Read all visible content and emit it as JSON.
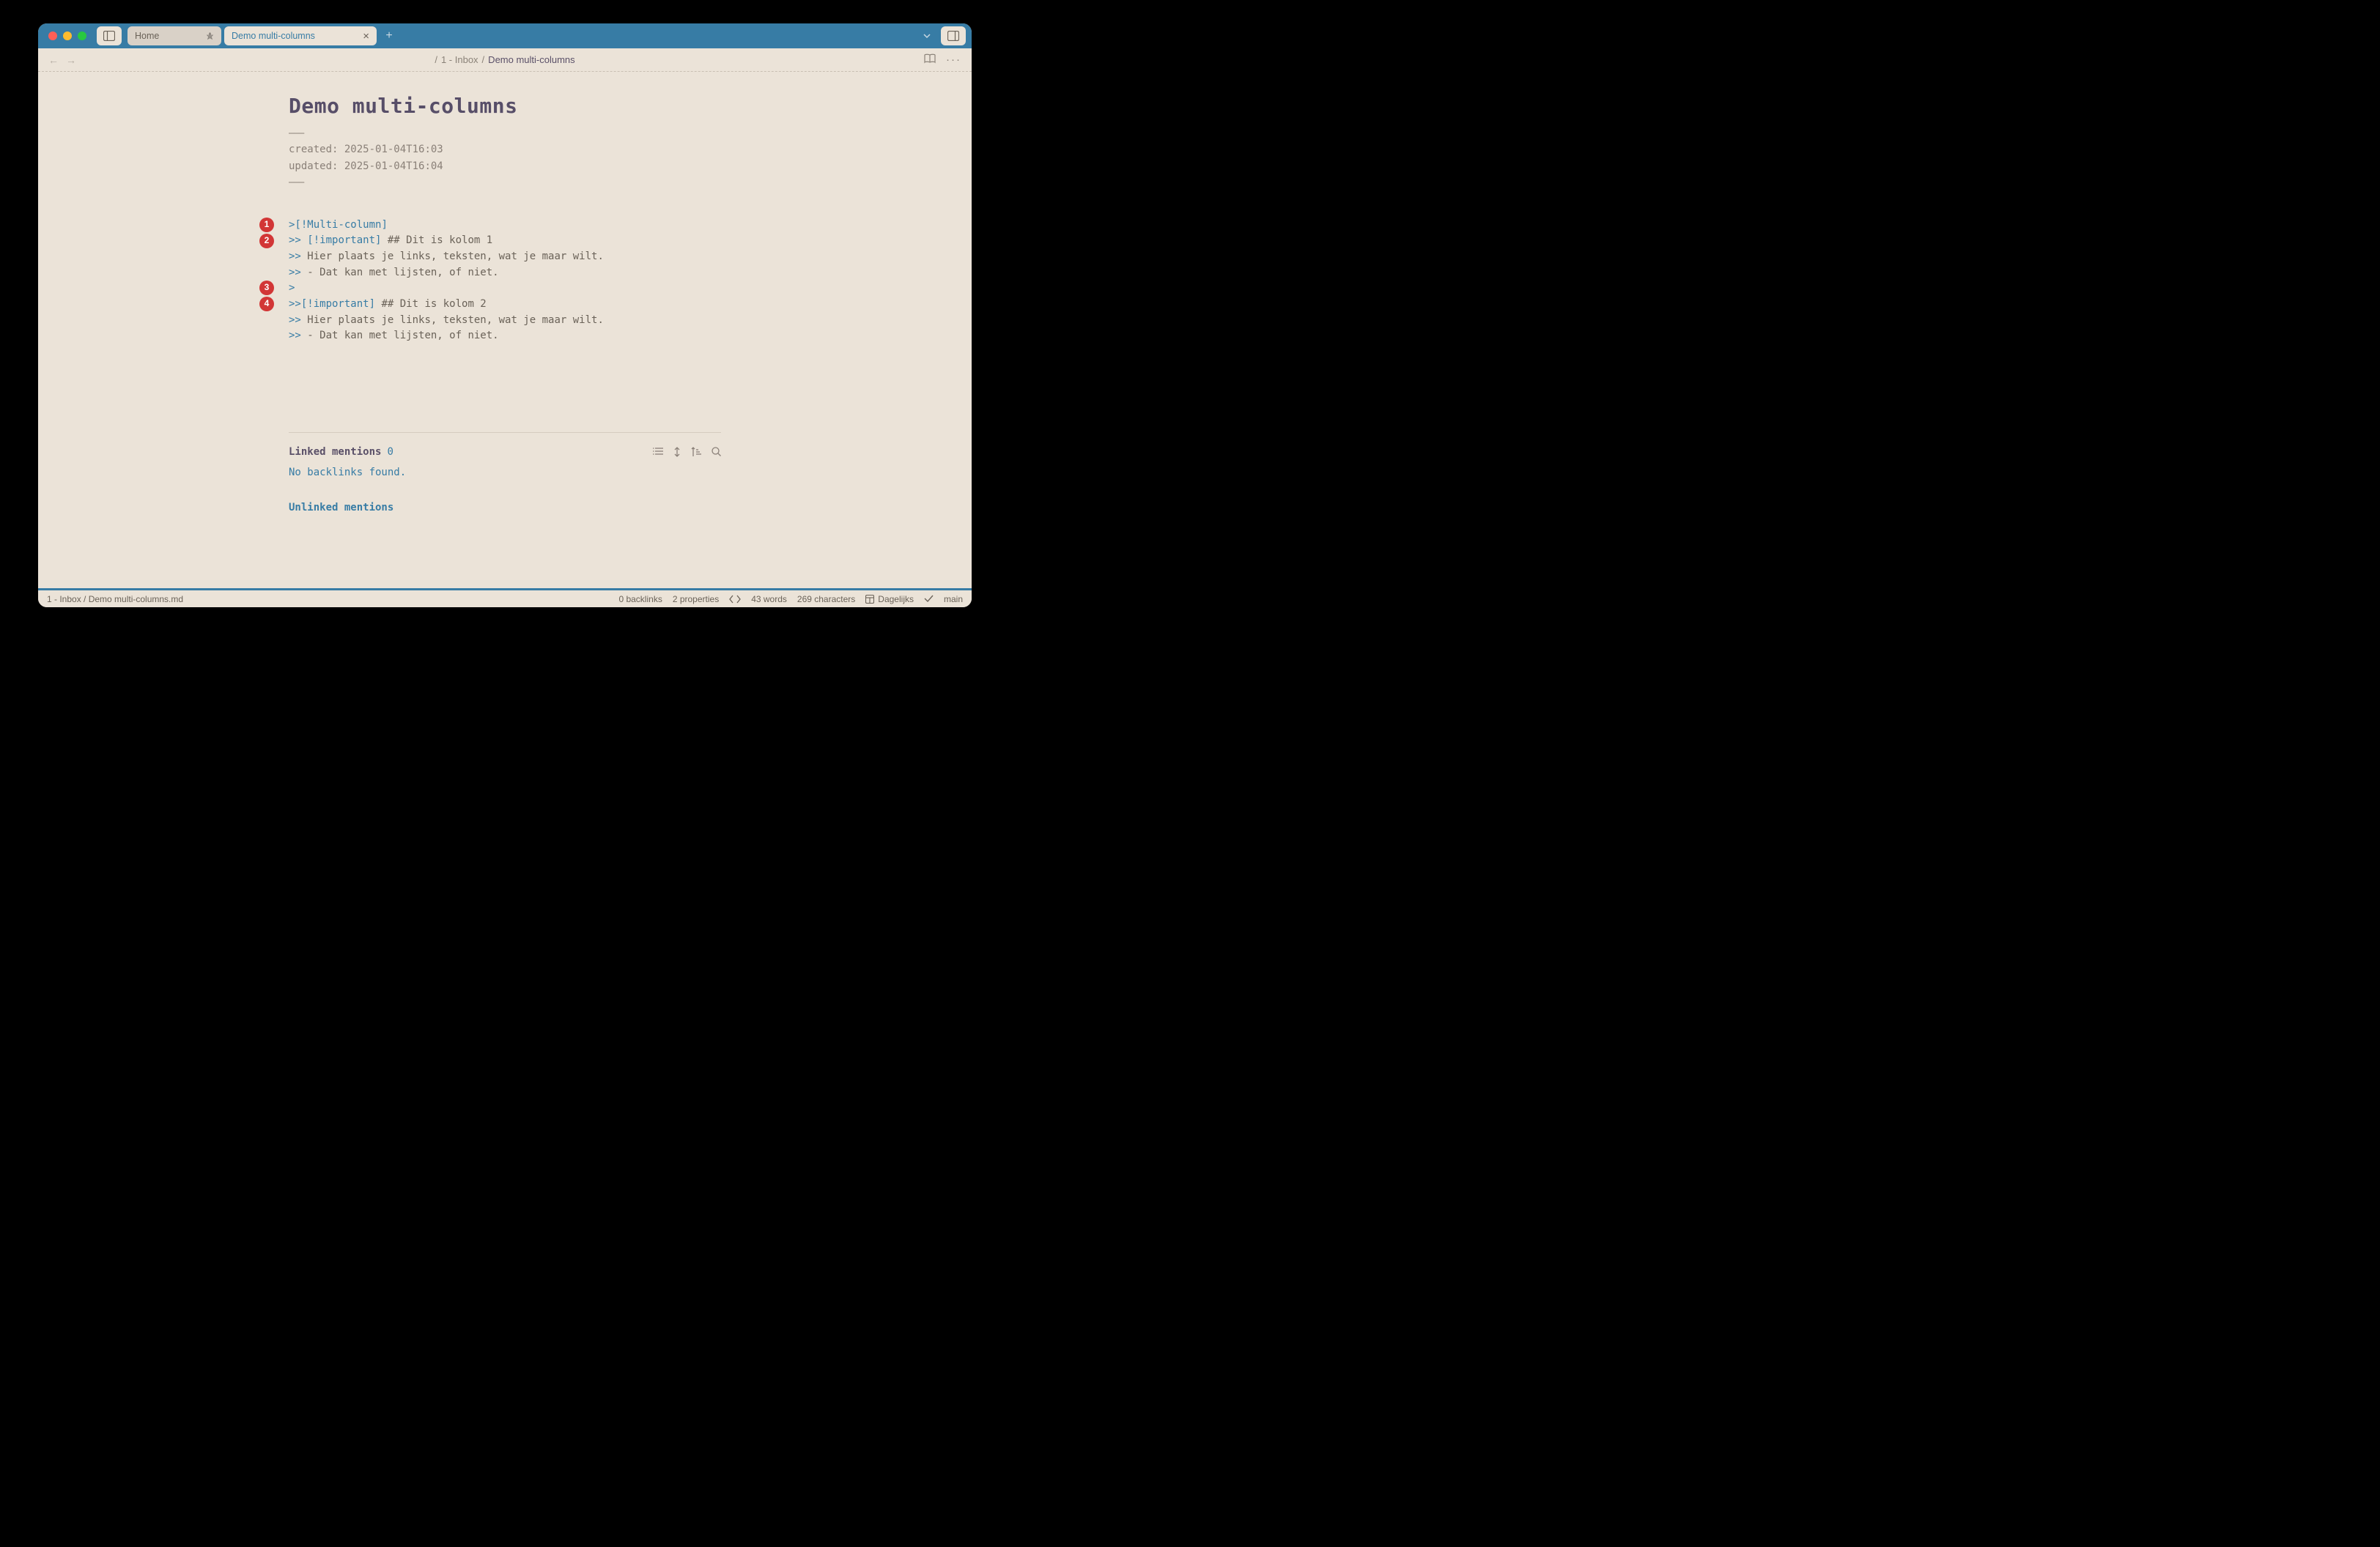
{
  "tabs": {
    "home_label": "Home",
    "active_label": "Demo multi-columns"
  },
  "breadcrumb": {
    "part1": "1 - Inbox",
    "part2": "Demo multi-columns"
  },
  "doc": {
    "title": "Demo multi-columns",
    "frontmatter": {
      "created_label": "created:",
      "created_value": "2025-01-04T16:03",
      "updated_label": "updated:",
      "updated_value": "2025-01-04T16:04"
    },
    "lines": {
      "l1_marker": ">",
      "l1_callout": "[!Multi-column]",
      "l2_marker": ">> ",
      "l2_callout": "[!important]",
      "l2_text": " ## Dit is kolom 1",
      "l3_marker": ">> ",
      "l3_text": "Hier plaats je links, teksten, wat je maar wilt.",
      "l4_marker": ">> ",
      "l4_text": "- Dat kan met lijsten, of niet.",
      "l5_marker": ">",
      "l6_marker": ">>",
      "l6_callout": "[!important]",
      "l6_text": " ## Dit is kolom 2",
      "l7_marker": ">> ",
      "l7_text": "Hier plaats je links, teksten, wat je maar wilt.",
      "l8_marker": ">> ",
      "l8_text": "- Dat kan met lijsten, of niet."
    },
    "badges": {
      "b1": "1",
      "b2": "2",
      "b3": "3",
      "b4": "4"
    }
  },
  "backlinks": {
    "header": "Linked mentions",
    "count": "0",
    "empty": "No backlinks found.",
    "unlinked": "Unlinked mentions"
  },
  "statusbar": {
    "path": "1 - Inbox / Demo multi-columns.md",
    "backlinks": "0 backlinks",
    "properties": "2 properties",
    "words": "43 words",
    "chars": "269 characters",
    "workspace": "Dagelijks",
    "branch": "main"
  }
}
